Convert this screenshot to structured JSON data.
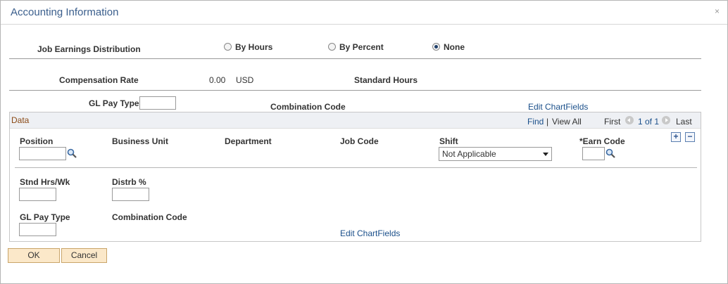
{
  "dialog": {
    "title": "Accounting Information",
    "close_glyph": "×"
  },
  "job_earnings": {
    "label": "Job Earnings Distribution",
    "options": [
      {
        "label": "By Hours",
        "selected": false
      },
      {
        "label": "By Percent",
        "selected": false
      },
      {
        "label": "None",
        "selected": true
      }
    ]
  },
  "compensation": {
    "rate_label": "Compensation Rate",
    "rate_value": "0.00",
    "currency": "USD",
    "standard_hours_label": "Standard Hours"
  },
  "header_fields": {
    "gl_pay_type_label": "GL Pay Type",
    "gl_pay_type_value": "",
    "combination_code_label": "Combination Code",
    "edit_chartfields_link": "Edit ChartFields"
  },
  "data_grid": {
    "title": "Data",
    "find_link": "Find",
    "separator": "|",
    "view_all_link": "View All",
    "first_label": "First",
    "page_info": "1 of 1",
    "last_label": "Last",
    "add_glyph": "+",
    "remove_glyph": "−",
    "columns": {
      "position": "Position",
      "business_unit": "Business Unit",
      "department": "Department",
      "job_code": "Job Code",
      "shift": "Shift",
      "earn_code": "*Earn Code"
    },
    "row": {
      "position_value": "",
      "shift_value": "Not Applicable",
      "earn_code_value": "",
      "stnd_hrs_label": "Stnd Hrs/Wk",
      "stnd_hrs_value": "",
      "distrb_label": "Distrb %",
      "distrb_value": "",
      "gl_pay_type_label": "GL Pay Type",
      "gl_pay_type_value": "",
      "combination_code_label": "Combination Code",
      "edit_chartfields_link": "Edit ChartFields"
    }
  },
  "buttons": {
    "ok": "OK",
    "cancel": "Cancel"
  },
  "colors": {
    "title": "#3a5e8c",
    "link": "#1a4f8a",
    "grid_title": "#8b4a16",
    "button_bg": "#fbe8c9"
  }
}
